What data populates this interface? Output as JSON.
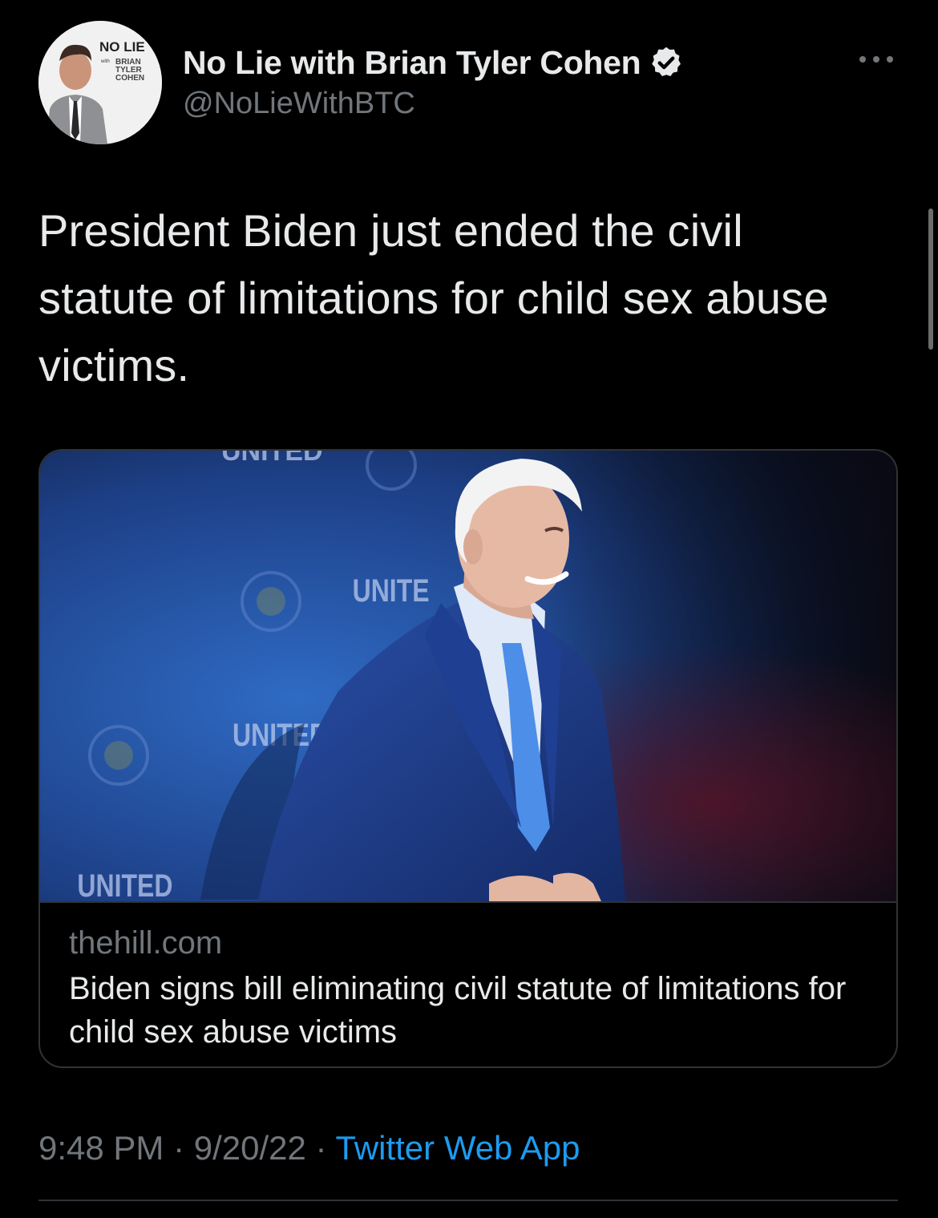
{
  "author": {
    "display_name": "No Lie with Brian Tyler Cohen",
    "handle": "@NoLieWithBTC",
    "avatar_logo_lines": [
      "NO LIE",
      "with",
      "BRIAN",
      "TYLER",
      "COHEN"
    ],
    "verified_icon": "verified-badge-icon"
  },
  "tweet": {
    "text": "President Biden just ended the civil statute of limitations for child sex abuse victims."
  },
  "card": {
    "domain": "thehill.com",
    "title": "Biden signs bill eliminating civil statute of limitations for child sex abuse victims",
    "image_backdrop_text": [
      "UNITED",
      "UNITE",
      "UNITED",
      "UNITED"
    ]
  },
  "meta": {
    "time": "9:48 PM",
    "separator": " · ",
    "date": "9/20/22",
    "source": "Twitter Web App"
  },
  "colors": {
    "background": "#000000",
    "primary_text": "#e7e9ea",
    "secondary_text": "#71767b",
    "link": "#1d9bf0",
    "border": "#2f3336"
  }
}
